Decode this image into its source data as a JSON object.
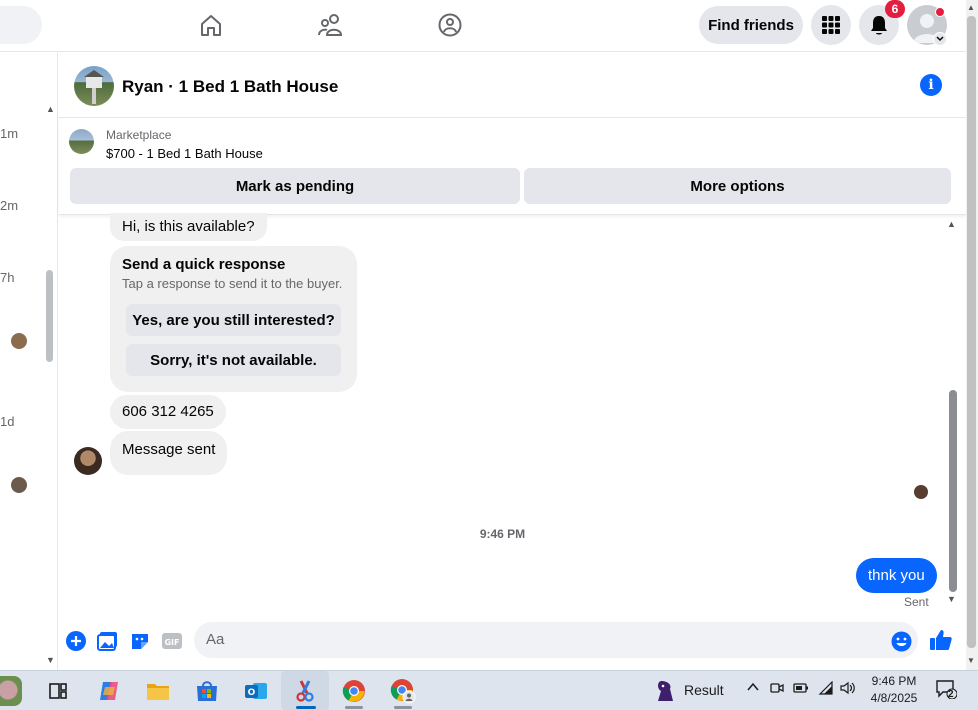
{
  "topnav": {
    "find_friends_label": "Find friends",
    "notification_count": "6",
    "icons": [
      "home-icon",
      "friends-icon",
      "groups-icon",
      "menu-grid-icon",
      "bell-icon",
      "account-avatar"
    ]
  },
  "left_list": {
    "times": [
      "1m",
      "2m",
      "7h",
      "1d"
    ]
  },
  "conversation": {
    "title": "Ryan · 1 Bed 1 Bath House",
    "marketplace": {
      "label": "Marketplace",
      "listing": "$700 - 1 Bed 1 Bath House",
      "mark_pending_label": "Mark as pending",
      "more_options_label": "More options"
    },
    "messages": {
      "first": "Hi, is this available?",
      "quick_response": {
        "title": "Send a quick response",
        "subtitle": "Tap a response to send it to the buyer.",
        "option_1": "Yes, are you still interested?",
        "option_2": "Sorry, it's not available."
      },
      "phone": "606 312 4265",
      "message_sent": "Message sent",
      "timestamp": "9:46 PM",
      "mine": "thnk you",
      "status": "Sent"
    },
    "composer": {
      "placeholder": "Aa"
    }
  },
  "taskbar": {
    "result_label": "Result",
    "time": "9:46 PM",
    "date": "4/8/2025",
    "notification_count": "2"
  },
  "colors": {
    "accent": "#0866ff",
    "bubble_gray": "#f0f0f0",
    "button_gray": "#e4e6eb",
    "badge_red": "#e41e3f"
  }
}
